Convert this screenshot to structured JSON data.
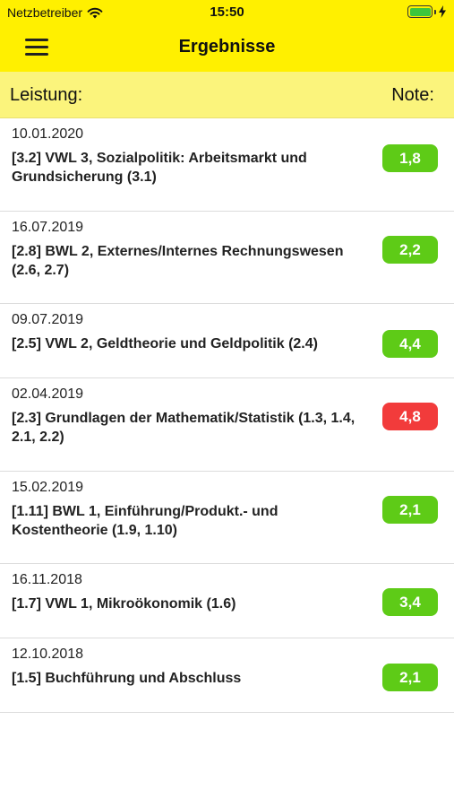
{
  "status": {
    "carrier": "Netzbetreiber",
    "time": "15:50"
  },
  "nav": {
    "title": "Ergebnisse"
  },
  "columns": {
    "left": "Leistung:",
    "right": "Note:"
  },
  "colors": {
    "bar": "#fff000",
    "header": "#fbf47c",
    "pass": "#5ecb17",
    "fail": "#f23b3b"
  },
  "results": [
    {
      "date": "10.01.2020",
      "title": "[3.2] VWL 3, Sozialpolitik: Arbeitsmarkt und Grundsicherung (3.1)",
      "grade": "1,8",
      "status": "pass"
    },
    {
      "date": "16.07.2019",
      "title": "[2.8] BWL 2, Externes/Internes Rechnungswesen (2.6, 2.7)",
      "grade": "2,2",
      "status": "pass"
    },
    {
      "date": "09.07.2019",
      "title": "[2.5] VWL 2, Geldtheorie und Geldpolitik (2.4)",
      "grade": "4,4",
      "status": "pass"
    },
    {
      "date": "02.04.2019",
      "title": "[2.3] Grundlagen der Mathematik/Statistik (1.3, 1.4, 2.1, 2.2)",
      "grade": "4,8",
      "status": "fail"
    },
    {
      "date": "15.02.2019",
      "title": "[1.11] BWL 1, Einführung/Produkt.- und Kostentheorie (1.9, 1.10)",
      "grade": "2,1",
      "status": "pass"
    },
    {
      "date": "16.11.2018",
      "title": "[1.7] VWL 1, Mikroökonomik (1.6)",
      "grade": "3,4",
      "status": "pass"
    },
    {
      "date": "12.10.2018",
      "title": "[1.5] Buchführung und Abschluss",
      "grade": "2,1",
      "status": "pass"
    }
  ]
}
